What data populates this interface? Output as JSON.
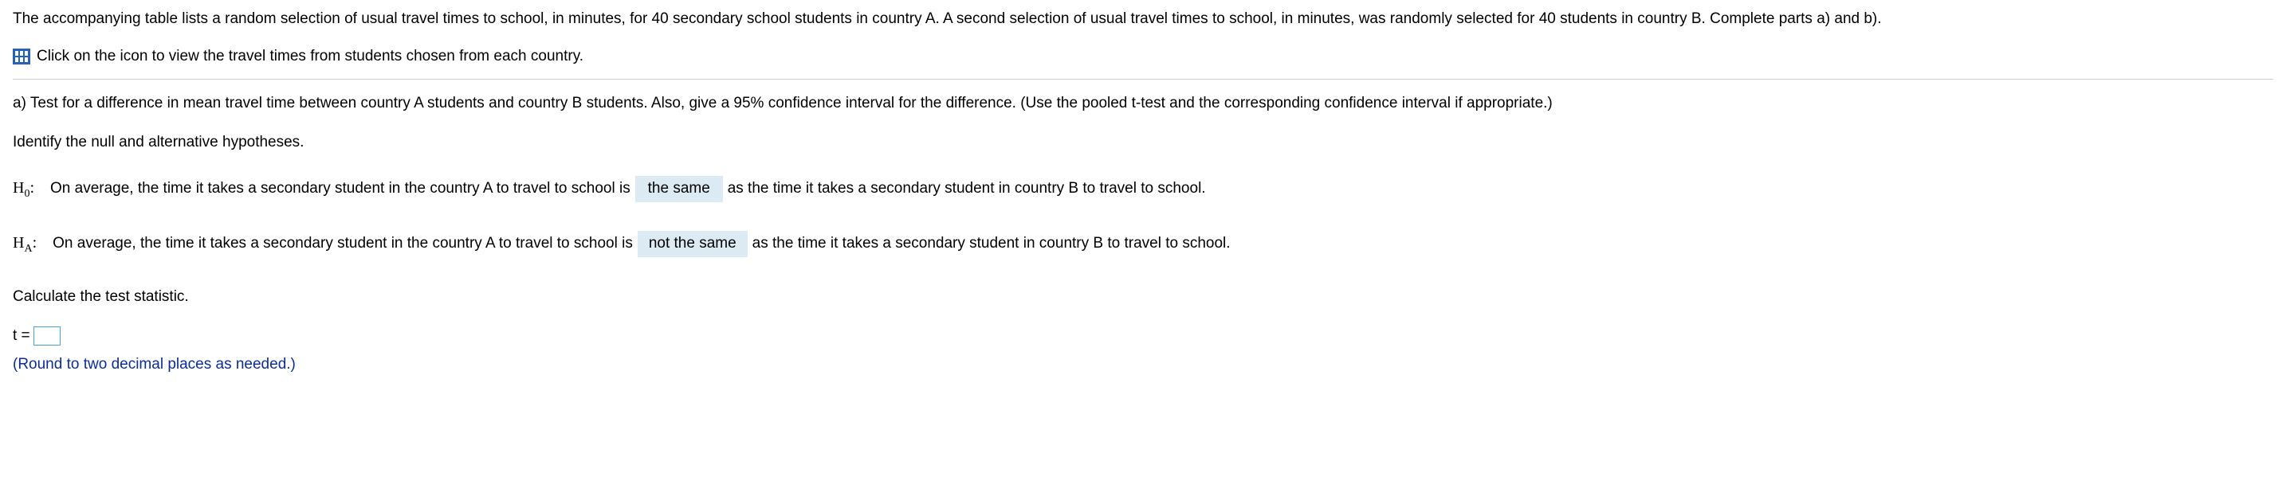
{
  "intro": "The accompanying table lists a random selection of usual travel times to school, in minutes, for 40 secondary school students in country A. A second selection of usual travel times to school, in minutes, was randomly selected for 40 students in country B. Complete parts a) and b).",
  "dataLinkText": "Click on the icon to view the travel times from students chosen from each country.",
  "partA": "a) Test for a difference in mean travel time between country A students and country B students. Also, give a 95% confidence interval for the difference. (Use the pooled t-test and the corresponding confidence interval if appropriate.)",
  "identifyHypotheses": "Identify the null and alternative hypotheses.",
  "h0": {
    "labelMain": "H",
    "labelSub": "0",
    "colon": ":",
    "before": "On average, the time it takes a secondary student in the country A to travel to school is",
    "selected": "the same",
    "after": "as the time it takes a secondary student in country B to travel to school."
  },
  "ha": {
    "labelMain": "H",
    "labelSub": "A",
    "colon": ":",
    "before": "On average, the time it takes a secondary student in the country A to travel to school is",
    "selected": "not the same",
    "after": "as the time it takes a secondary student in country B to travel to school."
  },
  "calcStat": "Calculate the test statistic.",
  "tEquals": "t =",
  "tValue": "",
  "hint": "(Round to two decimal places as needed.)"
}
